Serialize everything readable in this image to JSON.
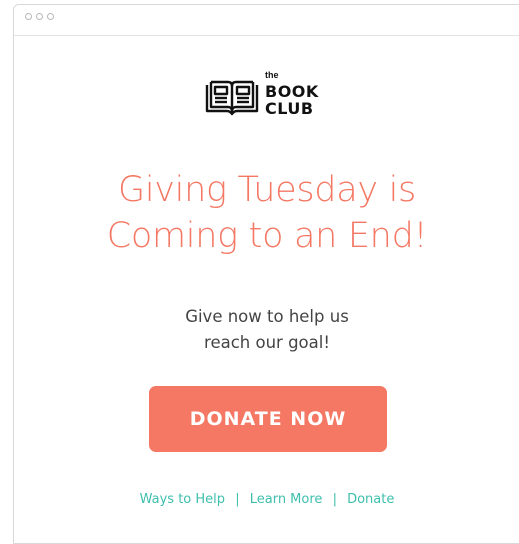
{
  "logo": {
    "the": "the",
    "line1": "BOOK",
    "line2": "CLUB"
  },
  "headline": {
    "line1": "Giving Tuesday is",
    "line2": "Coming to an End!"
  },
  "subtext": {
    "line1": "Give now to help us",
    "line2": "reach our goal!"
  },
  "cta": {
    "label": "DONATE NOW"
  },
  "footer": {
    "links": [
      "Ways to Help",
      "Learn More",
      "Donate"
    ],
    "separator": "|"
  },
  "colors": {
    "accent": "#f47864",
    "link": "#3fbfad",
    "text": "#444444"
  }
}
